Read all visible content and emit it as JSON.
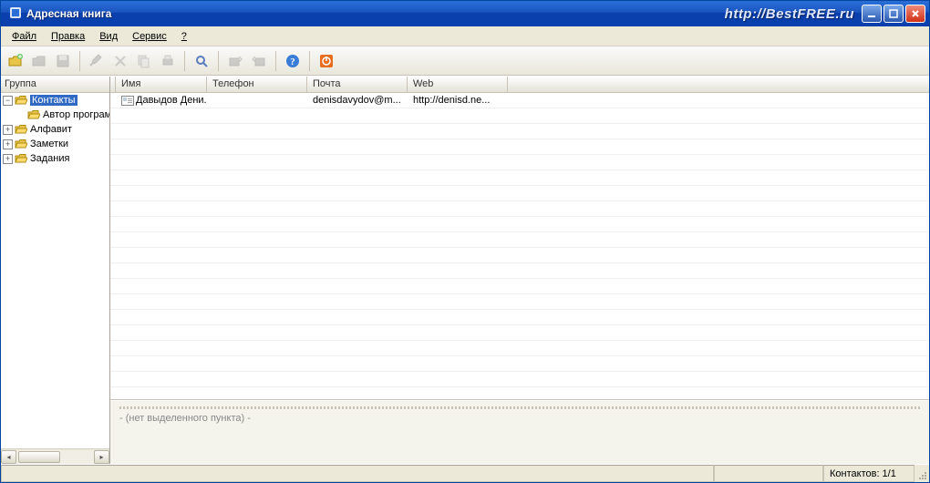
{
  "window": {
    "title": "Адресная книга",
    "watermark": "http://BestFREE.ru"
  },
  "menu": {
    "file": "Файл",
    "edit": "Правка",
    "view": "Вид",
    "tools": "Сервис",
    "help": "?"
  },
  "toolbar": {
    "new_contact": "new-contact",
    "open": "open",
    "save": "save",
    "edit": "edit",
    "delete": "delete",
    "copy": "copy",
    "print": "print",
    "find": "find",
    "export": "export",
    "import": "import",
    "help": "help",
    "power": "power"
  },
  "tree": {
    "header": "Группа",
    "items": [
      {
        "label": "Контакты",
        "expanded": true,
        "selected": true,
        "depth": 0
      },
      {
        "label": "Автор программы",
        "expanded": null,
        "selected": false,
        "depth": 1
      },
      {
        "label": "Алфавит",
        "expanded": false,
        "selected": false,
        "depth": 0
      },
      {
        "label": "Заметки",
        "expanded": false,
        "selected": false,
        "depth": 0
      },
      {
        "label": "Задания",
        "expanded": false,
        "selected": false,
        "depth": 0
      }
    ]
  },
  "table": {
    "columns": {
      "name": "Имя",
      "phone": "Телефон",
      "mail": "Почта",
      "web": "Web"
    },
    "rows": [
      {
        "name": "Давыдов Дени...",
        "phone": "",
        "mail": "denisdavydov@m...",
        "web": "http://denisd.ne..."
      }
    ],
    "empty_rows": 20
  },
  "detail": {
    "empty_text": "- (нет выделенного пункта) -"
  },
  "status": {
    "contacts": "Контактов: 1/1"
  }
}
